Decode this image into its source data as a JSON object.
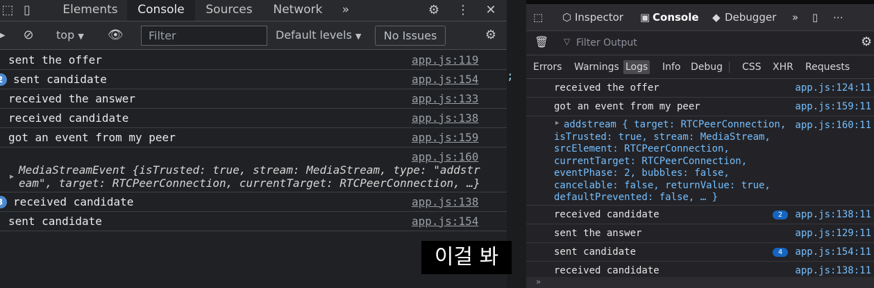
{
  "chrome": {
    "tabs": [
      "Elements",
      "Console",
      "Sources",
      "Network"
    ],
    "more_tabs": "»",
    "context": "top",
    "filter_placeholder": "Filter",
    "levels": "Default levels",
    "issues": "No Issues",
    "rows": [
      {
        "msg": "sent the offer",
        "src": "app.js:119"
      },
      {
        "badge": "2",
        "msg": "sent candidate",
        "src": "app.js:154"
      },
      {
        "msg": "received the answer",
        "src": "app.js:133"
      },
      {
        "msg": "received candidate",
        "src": "app.js:138"
      },
      {
        "msg": "got an event from my peer",
        "src": "app.js:159"
      },
      {
        "src": "app.js:160",
        "obj": "MediaStreamEvent {isTrusted: true, stream: MediaStream, type: \"addstream\", target: RTCPeerConnection, currentTarget: RTCPeerConnection, …}"
      },
      {
        "badge": "3",
        "msg": "received candidate",
        "src": "app.js:138"
      },
      {
        "msg": "sent candidate",
        "src": "app.js:154"
      }
    ]
  },
  "gap_mark": ";",
  "firefox": {
    "tabs": [
      "Inspector",
      "Console",
      "Debugger"
    ],
    "filter_placeholder": "Filter Output",
    "levels": [
      "Errors",
      "Warnings",
      "Logs",
      "Info",
      "Debug",
      "CSS",
      "XHR",
      "Requests"
    ],
    "active_level": "Logs",
    "rows": [
      {
        "msg": "received the offer",
        "src": "app.js:124:11"
      },
      {
        "msg": "got an event from my peer",
        "src": "app.js:159:11"
      },
      {
        "obj": "addstream { target: RTCPeerConnection, isTrusted: true, stream: MediaStream, srcElement: RTCPeerConnection, currentTarget: RTCPeerConnection, eventPhase: 2, bubbles: false, cancelable: false, returnValue: true, defaultPrevented: false, … }",
        "src": "app.js:160:11"
      },
      {
        "msg": "received candidate",
        "badge": "2",
        "src": "app.js:138:11"
      },
      {
        "msg": "sent the answer",
        "src": "app.js:129:11"
      },
      {
        "msg": "sent candidate",
        "badge": "4",
        "src": "app.js:154:11"
      },
      {
        "msg": "received candidate",
        "src": "app.js:138:11"
      }
    ]
  },
  "subtitle": "이걸 봐",
  "colors": {
    "chrome_bg": "#202124",
    "firefox_bg": "#232327",
    "link": "#75bfff",
    "badge": "#4d8ad1"
  }
}
